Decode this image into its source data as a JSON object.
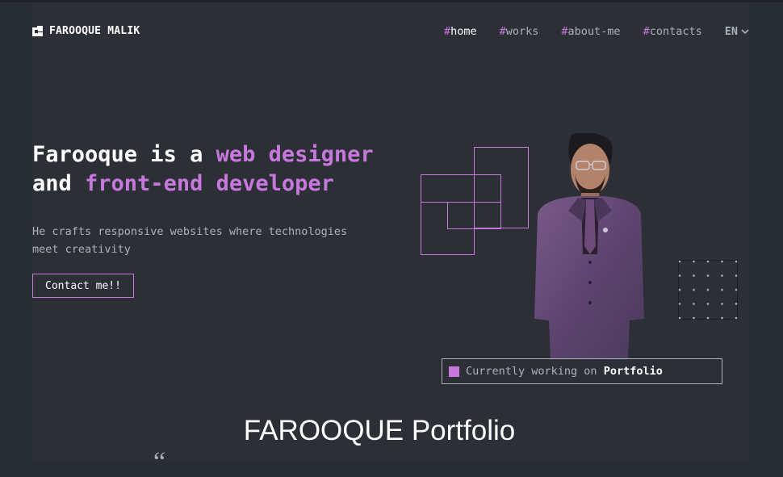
{
  "brand": {
    "name": "FAROOQUE MALIK",
    "icon": "brand-logo-icon"
  },
  "nav": {
    "items": [
      {
        "hash": "#",
        "label": "home",
        "active": true
      },
      {
        "hash": "#",
        "label": "works",
        "active": false
      },
      {
        "hash": "#",
        "label": "about-me",
        "active": false
      },
      {
        "hash": "#",
        "label": "contacts",
        "active": false
      }
    ],
    "language": "EN"
  },
  "hero": {
    "title_part1": "Farooque is a ",
    "title_accent1": "web designer",
    "title_part2": "and ",
    "title_accent2": "front-end developer",
    "description": "He crafts responsive websites where technologies meet creativity",
    "cta_label": "Contact me!!"
  },
  "status": {
    "prefix": "Currently working on ",
    "project": "Portfolio"
  },
  "section": {
    "title": "FAROOQUE Portfolio",
    "quote_mark": "“"
  },
  "colors": {
    "background": "#282c33",
    "accent": "#c778dd",
    "text": "#abb2bf",
    "white": "#ffffff"
  }
}
